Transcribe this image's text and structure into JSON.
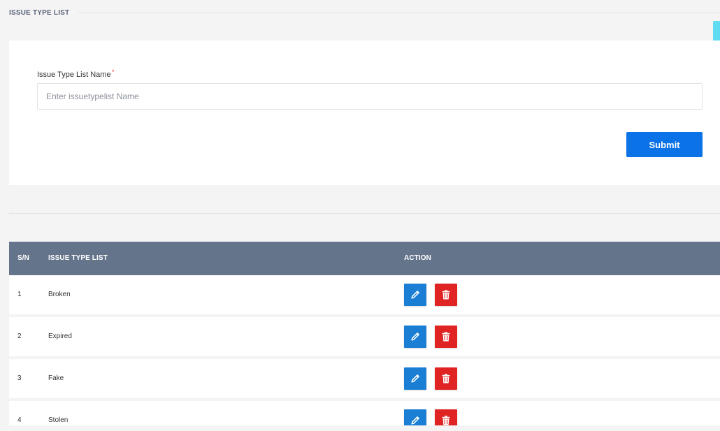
{
  "section": {
    "title": "ISSUE TYPE LIST"
  },
  "form": {
    "label": "Issue Type List Name",
    "required_mark": "*",
    "input_value": "",
    "input_placeholder": "Enter issuetypelist Name",
    "submit_label": "Submit"
  },
  "table": {
    "headers": {
      "sn": "S/N",
      "name": "ISSUE TYPE LIST",
      "action": "ACTION"
    },
    "rows": [
      {
        "sn": "1",
        "name": "Broken"
      },
      {
        "sn": "2",
        "name": "Expired"
      },
      {
        "sn": "3",
        "name": "Fake"
      },
      {
        "sn": "4",
        "name": "Stolen"
      }
    ]
  },
  "icons": {
    "edit": "pencil-icon",
    "delete": "trash-icon"
  },
  "colors": {
    "primary": "#0b72e7",
    "edit": "#1a7fd4",
    "delete": "#e02424",
    "table_header": "#64748b",
    "scroll_accent": "#5fdcf2"
  }
}
